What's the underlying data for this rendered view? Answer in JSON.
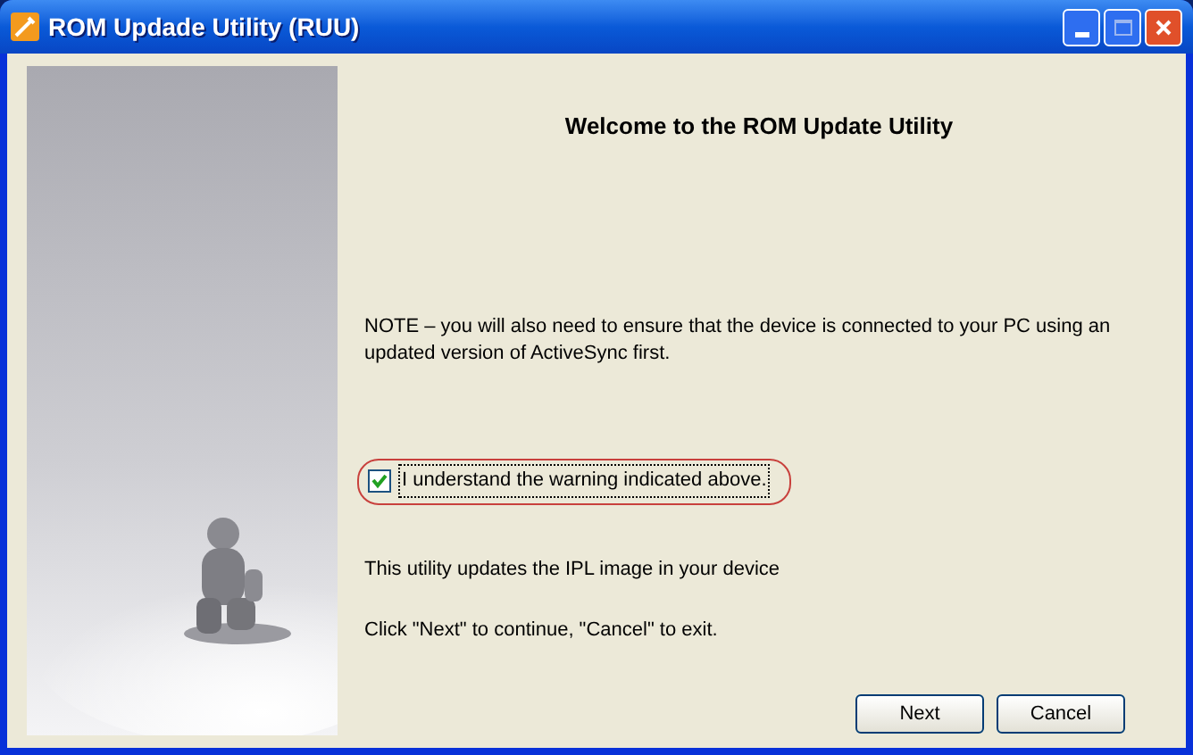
{
  "window": {
    "title": "ROM Updade Utility (RUU)"
  },
  "heading": "Welcome to the ROM Update Utility",
  "note": "NOTE – you will also need to ensure that the device is connected to your PC using an updated version of ActiveSync first.",
  "agree": {
    "label": "I understand the warning indicated above.",
    "checked": true
  },
  "info": "This utility updates the IPL image in your device",
  "hint": "Click \"Next\" to continue, \"Cancel\" to exit.",
  "buttons": [
    "Next",
    "Cancel"
  ]
}
